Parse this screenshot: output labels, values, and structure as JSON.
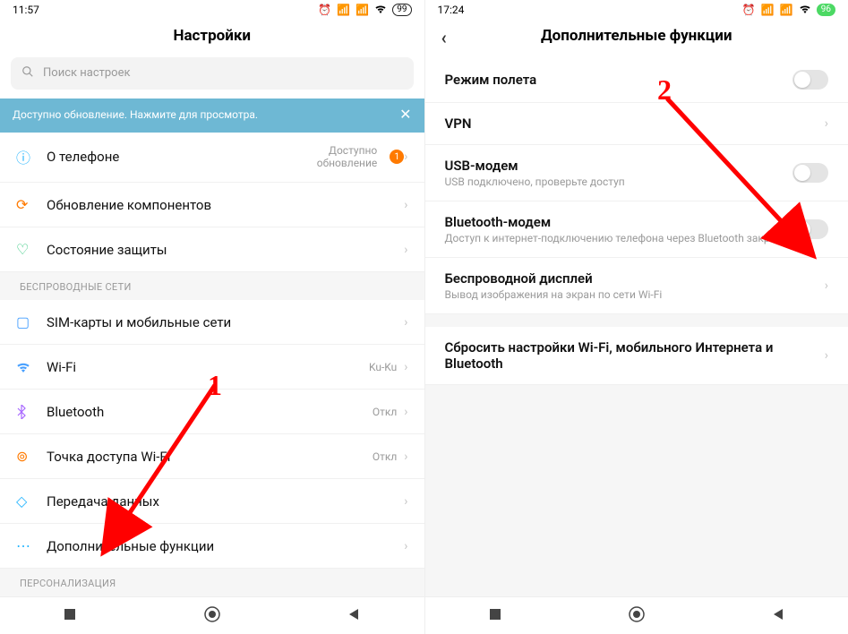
{
  "left": {
    "status": {
      "time": "11:57",
      "battery": "99"
    },
    "title": "Настройки",
    "search_placeholder": "Поиск настроек",
    "banner": "Доступно обновление. Нажмите для просмотра.",
    "rows1": [
      {
        "icon_name": "info-icon",
        "label": "О телефоне",
        "value": "Доступно обновление",
        "badge": "1"
      },
      {
        "icon_name": "update-icon",
        "label": "Обновление компонентов"
      },
      {
        "icon_name": "shield-icon",
        "label": "Состояние защиты"
      }
    ],
    "section1": "БЕСПРОВОДНЫЕ СЕТИ",
    "rows_wireless": [
      {
        "icon_name": "sim-icon",
        "label": "SIM-карты и мобильные сети"
      },
      {
        "icon_name": "wifi-icon",
        "label": "Wi-Fi",
        "value": "Ku-Ku"
      },
      {
        "icon_name": "bluetooth-icon",
        "label": "Bluetooth",
        "value": "Откл"
      },
      {
        "icon_name": "hotspot-icon",
        "label": "Точка доступа Wi-Fi",
        "value": "Откл"
      },
      {
        "icon_name": "data-icon",
        "label": "Передача данных"
      },
      {
        "icon_name": "more-icon",
        "label": "Дополнительные функции"
      }
    ],
    "section2": "ПЕРСОНАЛИЗАЦИЯ"
  },
  "right": {
    "status": {
      "time": "17:24",
      "battery": "96"
    },
    "title": "Дополнительные функции",
    "rows": [
      {
        "title": "Режим полета",
        "control": "toggle"
      },
      {
        "title": "VPN",
        "control": "chevron"
      },
      {
        "title": "USB-модем",
        "sub": "USB подключено, проверьте доступ",
        "control": "toggle"
      },
      {
        "title": "Bluetooth-модем",
        "sub": "Доступ к интернет-подключению телефона через Bluetooth закрыт",
        "control": "toggle"
      },
      {
        "title": "Беспроводной дисплей",
        "sub": "Вывод изображения на экран по сети Wi-Fi",
        "control": "chevron"
      }
    ],
    "reset_row": {
      "title": "Сбросить настройки Wi-Fi, мобильного Интернета и Bluetooth",
      "control": "chevron"
    }
  },
  "annotations": {
    "num1": "1",
    "num2": "2"
  }
}
